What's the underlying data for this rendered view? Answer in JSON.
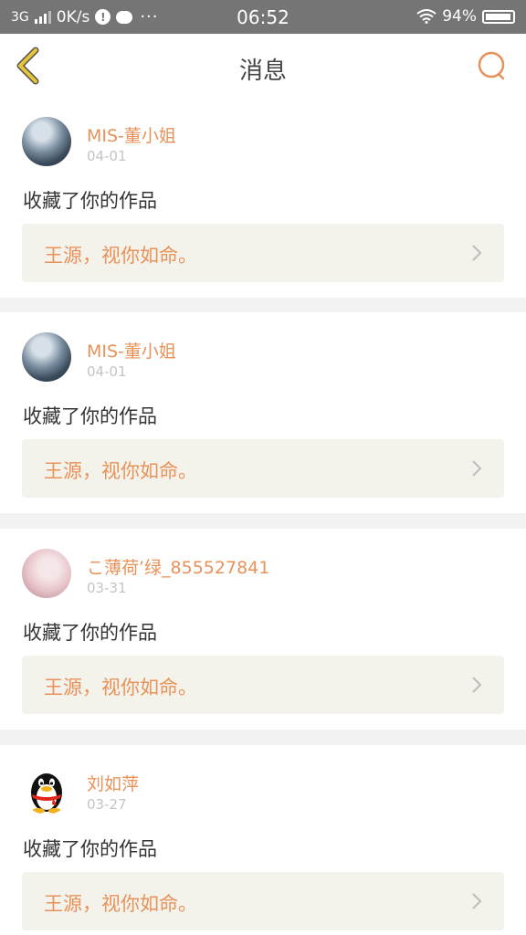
{
  "status": {
    "network": "3G",
    "speed": "0K/s",
    "time": "06:52",
    "battery": "94%",
    "alert_glyph": "!",
    "more_glyph": "···"
  },
  "header": {
    "title": "消息"
  },
  "colors": {
    "accent": "#e8925a",
    "back_icon": "#e8c53a",
    "card_bg": "#f3f3ec"
  },
  "messages": [
    {
      "user": "MIS-董小姐",
      "date": "04-01",
      "action": "收藏了你的作品",
      "work_title": "王源，视你如命。"
    },
    {
      "user": "MIS-董小姐",
      "date": "04-01",
      "action": "收藏了你的作品",
      "work_title": "王源，视你如命。"
    },
    {
      "user": "こ薄荷’绿_855527841",
      "date": "03-31",
      "action": "收藏了你的作品",
      "work_title": "王源，视你如命。"
    },
    {
      "user": "刘如萍",
      "date": "03-27",
      "action": "收藏了你的作品",
      "work_title": "王源，视你如命。"
    }
  ]
}
